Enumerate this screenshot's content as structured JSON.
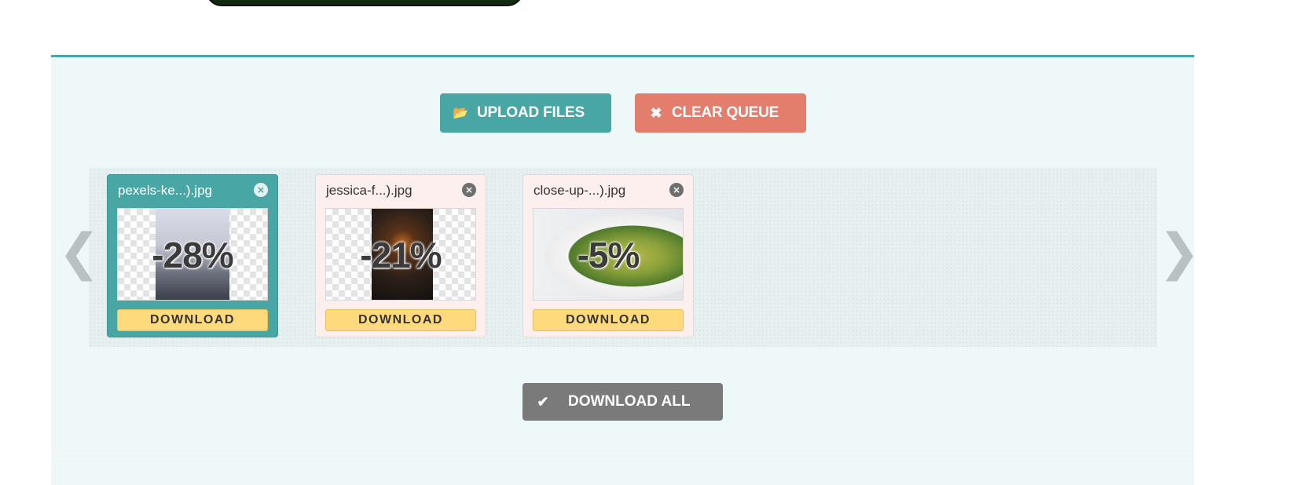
{
  "toolbar": {
    "upload_label": "UPLOAD FILES",
    "upload_icon": "folder-open-icon",
    "clear_label": "CLEAR QUEUE",
    "clear_icon": "close-icon",
    "upload_color": "#48a6a4",
    "clear_color": "#e47e6c"
  },
  "queue": {
    "prev_arrow": "❮",
    "next_arrow": "❯",
    "cards": [
      {
        "filename": "pexels-ke...).jpg",
        "reduction": "-28%",
        "download_label": "DOWNLOAD",
        "selected": true
      },
      {
        "filename": "jessica-f...).jpg",
        "reduction": "-21%",
        "download_label": "DOWNLOAD",
        "selected": false
      },
      {
        "filename": "close-up-...).jpg",
        "reduction": "-5%",
        "download_label": "DOWNLOAD",
        "selected": false
      }
    ],
    "close_glyph": "×"
  },
  "footer": {
    "download_all_label": "DOWNLOAD ALL",
    "download_all_icon": "checkmark-icon",
    "download_all_color": "#7a7a7a"
  },
  "colors": {
    "accent": "#48a6a4",
    "download_button": "#ffda7d",
    "panel_background": "#eff8f9"
  }
}
